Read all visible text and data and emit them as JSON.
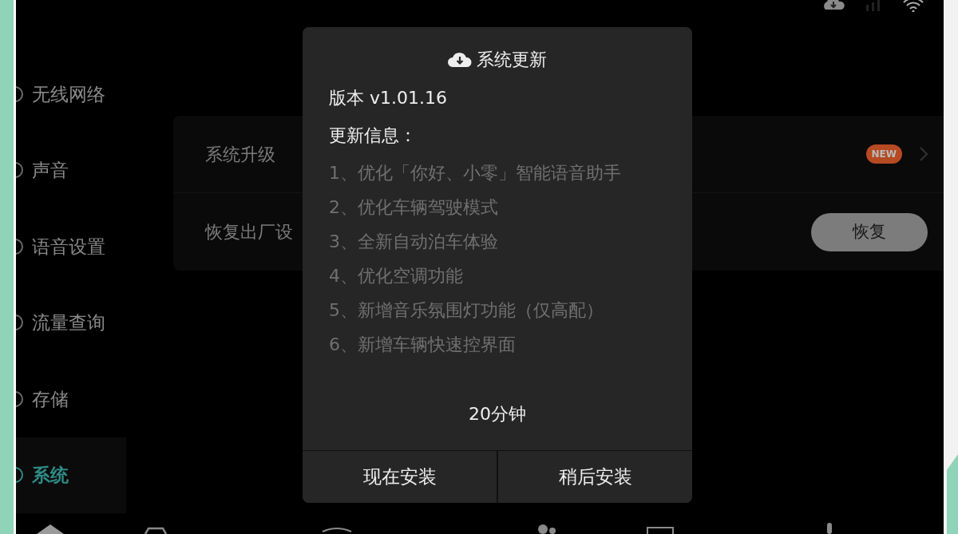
{
  "sidebar": {
    "items": [
      {
        "label": "无线网络",
        "selected": false
      },
      {
        "label": "声音",
        "selected": false
      },
      {
        "label": "语音设置",
        "selected": false
      },
      {
        "label": "流量查询",
        "selected": false
      },
      {
        "label": "存储",
        "selected": false
      },
      {
        "label": "系统",
        "selected": true
      }
    ]
  },
  "settings_rows": [
    {
      "kind": "badge",
      "label": "系统升级",
      "badge": "NEW"
    },
    {
      "kind": "button",
      "label": "恢复出厂设",
      "button": "恢复"
    }
  ],
  "dialog": {
    "title": "系统更新",
    "version": "版本 v1.01.16",
    "notes_heading": "更新信息：",
    "notes": [
      "1、优化「你好、小零」智能语音助手",
      "2、优化车辆驾驶模式",
      "3、全新自动泊车体验",
      "4、优化空调功能",
      "5、新增音乐氛围灯功能（仅高配）",
      "6、新增车辆快速控界面"
    ],
    "duration": "20分钟",
    "buttons": [
      "现在安装",
      "稍后安装"
    ]
  }
}
